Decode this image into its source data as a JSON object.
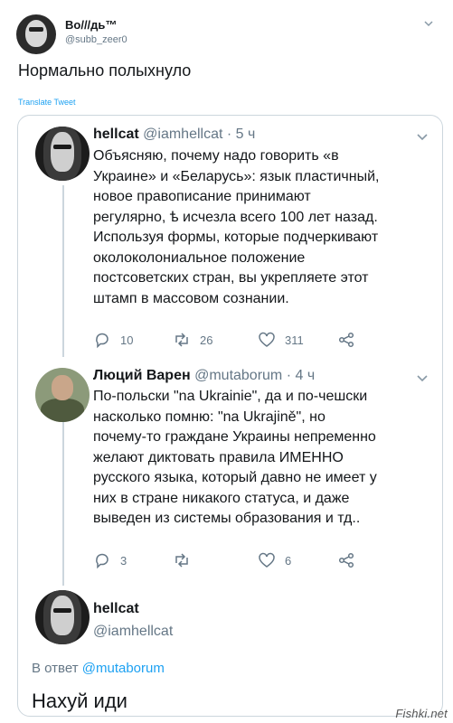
{
  "outer_tweet": {
    "name": "Во///дь™",
    "handle": "@subb_zeer0",
    "text": "Нормально полыхнуло",
    "translate_label": "Translate Tweet"
  },
  "thread": [
    {
      "name": "hellcat",
      "handle": "@iamhellcat",
      "time": "· 5 ч",
      "lines": [
        "Объясняю, почему надо говорить «в",
        "Украине» и «Беларусь»: язык пластичный,",
        "новое правописание принимают",
        "регулярно, ѣ исчезла всего 100 лет назад.",
        "Используя формы, которые подчеркивают",
        "околоколониальное положение",
        "постсоветских стран, вы укрепляете этот",
        "штамп в массовом сознании."
      ],
      "replies": "10",
      "retweets": "26",
      "likes": "311"
    },
    {
      "name": "Люций Варен",
      "handle": "@mutaborum",
      "time": "· 4 ч",
      "lines": [
        "По-польски \"na Ukrainie\", да и по-чешски",
        "насколько помню: \"na Ukrajině\", но",
        "почему-то граждане Украины непременно",
        "желают диктовать правила ИМЕННО",
        "русского языка, который давно не имеет у",
        "них в стране никакого статуса, и даже",
        "выведен из системы образования и тд.."
      ],
      "replies": "3",
      "retweets": "",
      "likes": "6"
    }
  ],
  "final_tweet": {
    "name": "hellcat",
    "handle": "@iamhellcat",
    "reply_prefix": "В ответ",
    "reply_mention": "@mutaborum",
    "text": "Нахуй иди"
  },
  "watermark": "Fishki.net",
  "colors": {
    "link": "#1da1f2",
    "secondary_text": "#657786",
    "border": "#ccd6dd"
  }
}
